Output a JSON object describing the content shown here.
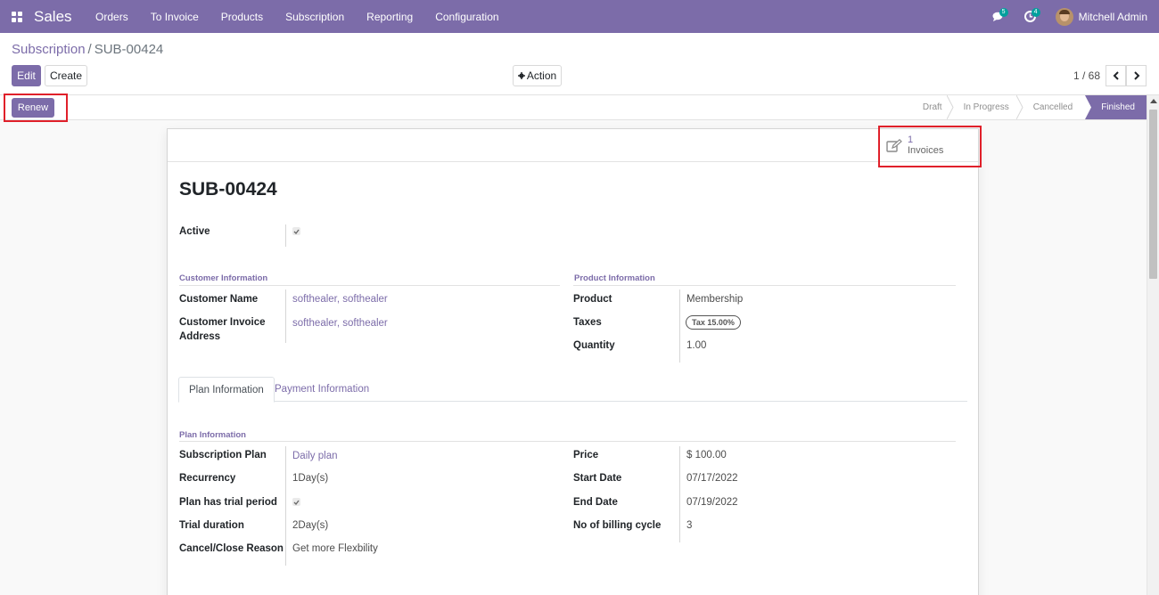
{
  "navbar": {
    "brand": "Sales",
    "menu": [
      "Orders",
      "To Invoice",
      "Products",
      "Subscription",
      "Reporting",
      "Configuration"
    ],
    "messages_count": "5",
    "activities_count": "4",
    "user_name": "Mitchell Admin"
  },
  "breadcrumb": {
    "parent": "Subscription",
    "separator": "/",
    "current": "SUB-00424"
  },
  "toolbar": {
    "edit_label": "Edit",
    "create_label": "Create",
    "action_label": "Action",
    "pager": "1 / 68"
  },
  "header": {
    "renew_label": "Renew",
    "stages": [
      {
        "label": "Draft",
        "active": false
      },
      {
        "label": "In Progress",
        "active": false
      },
      {
        "label": "Cancelled",
        "active": false
      },
      {
        "label": "Finished",
        "active": true
      }
    ]
  },
  "smart_button": {
    "count": "1",
    "label": "Invoices"
  },
  "form": {
    "title": "SUB-00424",
    "active_label": "Active",
    "active_checked": true,
    "customer_section": "Customer Information",
    "customer_name_label": "Customer Name",
    "customer_name": "softhealer, softhealer",
    "invoice_address_label_1": "Customer Invoice",
    "invoice_address_label_2": "Address",
    "invoice_address": "softhealer, softhealer",
    "product_section": "Product Information",
    "product_label": "Product",
    "product": "Membership",
    "taxes_label": "Taxes",
    "tax_tag": "Tax 15.00%",
    "quantity_label": "Quantity",
    "quantity": "1.00"
  },
  "tabs": [
    {
      "label": "Plan Information",
      "active": true
    },
    {
      "label": "Payment Information",
      "active": false
    }
  ],
  "plan": {
    "section": "Plan Information",
    "subscription_plan_label": "Subscription Plan",
    "subscription_plan": "Daily plan",
    "recurrency_label": "Recurrency",
    "recurrency": "1Day(s)",
    "trial_label": "Plan has trial period",
    "trial_checked": true,
    "trial_duration_label": "Trial duration",
    "trial_duration": "2Day(s)",
    "cancel_reason_label": "Cancel/Close Reason",
    "cancel_reason": "Get more Flexbility",
    "price_label": "Price",
    "price": "$ 100.00",
    "start_date_label": "Start Date",
    "start_date": "07/17/2022",
    "end_date_label": "End Date",
    "end_date": "07/19/2022",
    "billing_cycle_label": "No of billing cycle",
    "billing_cycle": "3"
  },
  "colors": {
    "brand": "#7c6ca9",
    "badge": "#00a09d",
    "highlight": "#e0202a"
  }
}
